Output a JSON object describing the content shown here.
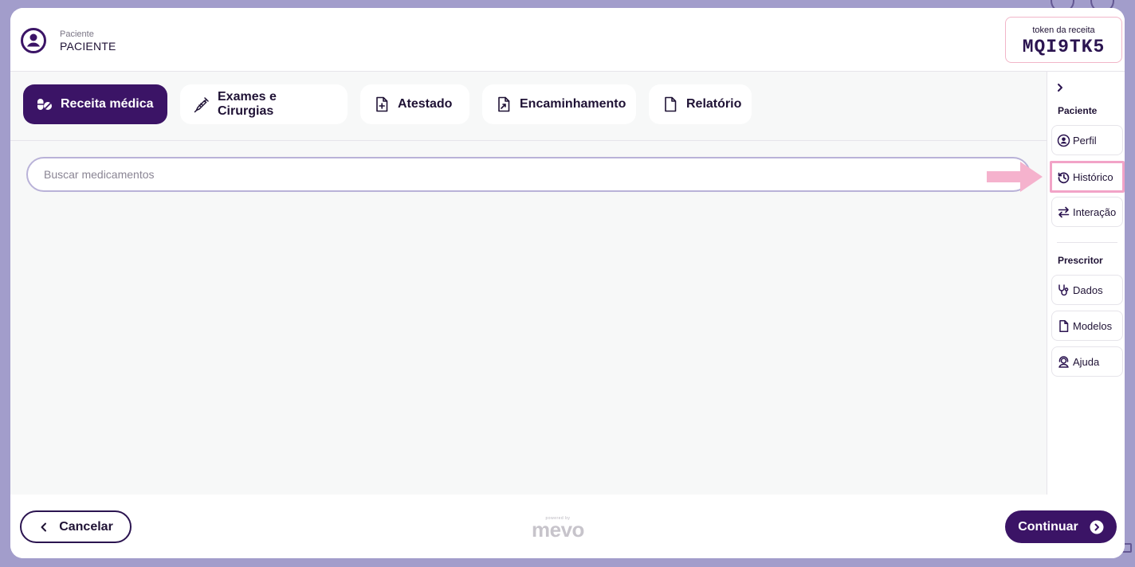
{
  "header": {
    "patient_caption": "Paciente",
    "patient_name": "PACIENTE",
    "token_label": "token da receita",
    "token_value": "MQI9TK5"
  },
  "tabs": [
    {
      "label": "Receita médica",
      "icon": "pills-icon",
      "active": true
    },
    {
      "label": "Exames e Cirurgias",
      "icon": "syringe-icon",
      "active": false
    },
    {
      "label": "Atestado",
      "icon": "document-plus-icon",
      "active": false
    },
    {
      "label": "Encaminhamento",
      "icon": "document-arrow-icon",
      "active": false
    },
    {
      "label": "Relatório",
      "icon": "document-icon",
      "active": false
    }
  ],
  "search": {
    "placeholder": "Buscar medicamentos",
    "value": ""
  },
  "sidebar": {
    "patient_section": "Paciente",
    "patient_items": [
      {
        "label": "Perfil",
        "icon": "profile-icon"
      },
      {
        "label": "Histórico",
        "icon": "history-icon",
        "highlighted": true
      },
      {
        "label": "Interação",
        "icon": "swap-arrows-icon"
      }
    ],
    "prescriber_section": "Prescritor",
    "prescriber_items": [
      {
        "label": "Dados",
        "icon": "stethoscope-icon"
      },
      {
        "label": "Modelos",
        "icon": "document-icon"
      },
      {
        "label": "Ajuda",
        "icon": "support-agent-icon"
      }
    ]
  },
  "footer": {
    "cancel_label": "Cancelar",
    "brand_small": "powered by",
    "brand_logo": "mevo",
    "continue_label": "Continuar"
  },
  "colors": {
    "primary": "#3b1466",
    "backdrop": "#a29dcb",
    "highlight": "#f2a3c7",
    "content_bg": "#f7f8f8"
  }
}
